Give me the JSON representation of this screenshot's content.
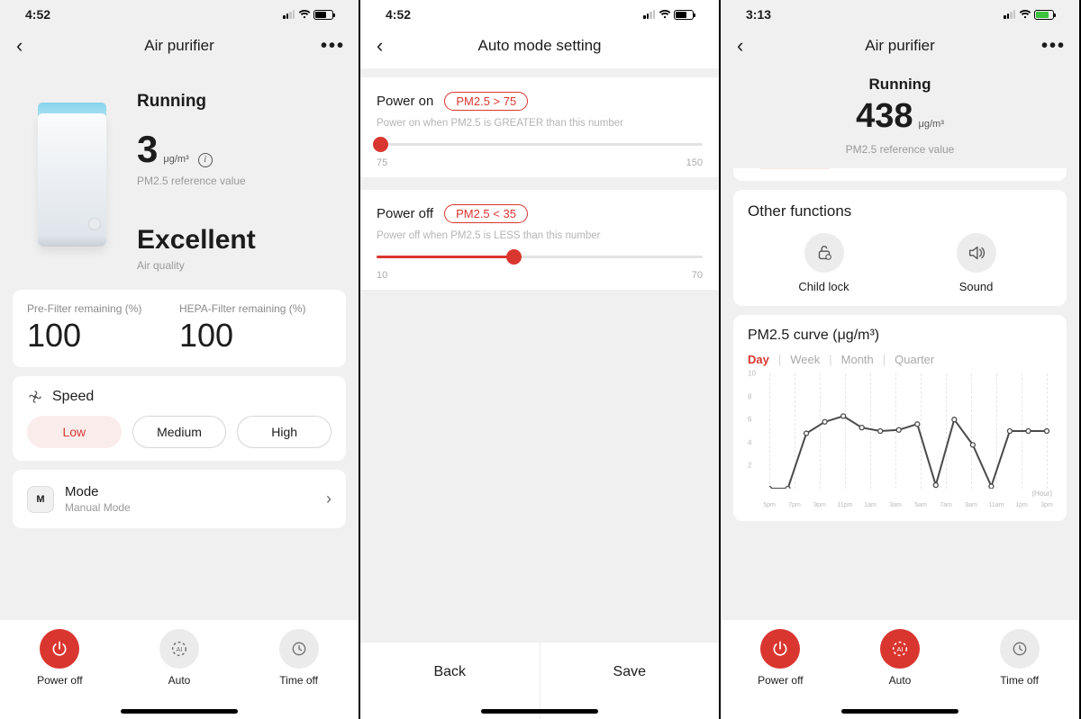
{
  "s1": {
    "time": "4:52",
    "title": "Air purifier",
    "running": "Running",
    "pm_value": "3",
    "pm_unit": "μg/m³",
    "pm_ref": "PM2.5 reference value",
    "quality": "Excellent",
    "aq_label": "Air quality",
    "pre_filter_label": "Pre-Filter remaining (%)",
    "pre_filter_val": "100",
    "hepa_label": "HEPA-Filter remaining (%)",
    "hepa_val": "100",
    "speed_label": "Speed",
    "speeds": {
      "low": "Low",
      "medium": "Medium",
      "high": "High"
    },
    "mode_title": "Mode",
    "mode_sub": "Manual Mode",
    "actions": {
      "power": "Power off",
      "auto": "Auto",
      "timer": "Time off"
    }
  },
  "s2": {
    "time": "4:52",
    "title": "Auto mode setting",
    "on": {
      "title": "Power on",
      "chip": "PM2.5 > 75",
      "desc": "Power on when PM2.5 is GREATER than this number",
      "min": "75",
      "max": "150"
    },
    "off": {
      "title": "Power off",
      "chip": "PM2.5 < 35",
      "desc": "Power off when PM2.5 is LESS than this number",
      "min": "10",
      "max": "70"
    },
    "back": "Back",
    "save": "Save"
  },
  "s3": {
    "time": "3:13",
    "title": "Air purifier",
    "running": "Running",
    "pm_value": "438",
    "pm_unit": "μg/m³",
    "pm_ref": "PM2.5 reference value",
    "other_title": "Other functions",
    "child_lock": "Child lock",
    "sound": "Sound",
    "curve_title": "PM2.5 curve (μg/m³)",
    "tabs": {
      "day": "Day",
      "week": "Week",
      "month": "Month",
      "quarter": "Quarter"
    },
    "hour_label": "(Hour)",
    "actions": {
      "power": "Power off",
      "auto": "Auto",
      "timer": "Time off"
    }
  },
  "chart_data": {
    "type": "line",
    "title": "PM2.5 curve (μg/m³)",
    "xlabel": "(Hour)",
    "ylabel": "",
    "ylim": [
      0,
      10
    ],
    "y_ticks": [
      0,
      2,
      4,
      6,
      8,
      10
    ],
    "categories": [
      "5pm",
      "7pm",
      "9pm",
      "11pm",
      "1am",
      "3am",
      "5am",
      "7am",
      "9am",
      "11am",
      "1pm",
      "3pm"
    ],
    "values": [
      0,
      0,
      4.8,
      5.8,
      6.3,
      5.3,
      5.0,
      5.1,
      5.6,
      0.3,
      6.0,
      3.8,
      0.2,
      5.0,
      5.0,
      5.0
    ]
  }
}
